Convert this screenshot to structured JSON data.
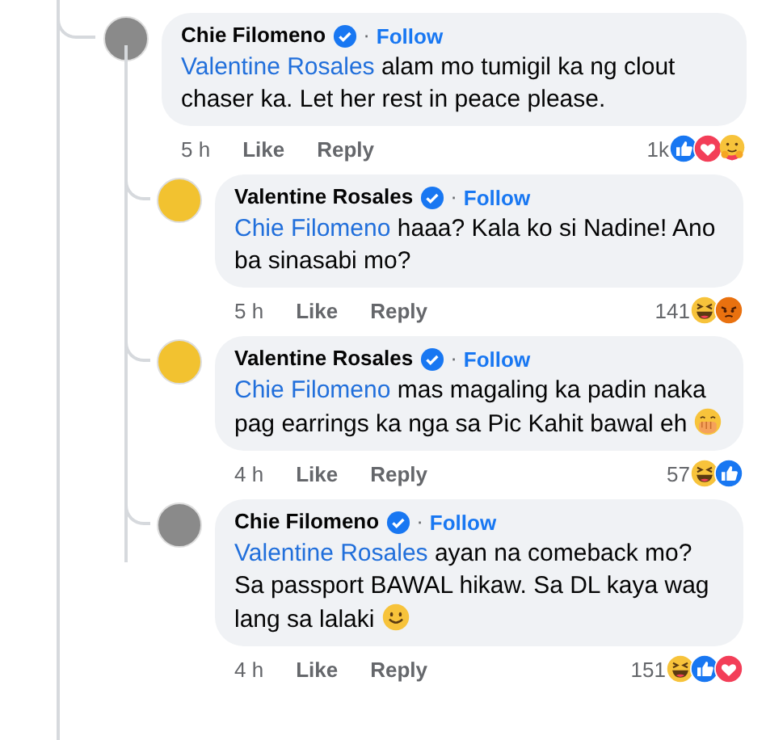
{
  "comments": [
    {
      "author": "Chie Filomeno",
      "verified": true,
      "separator": "·",
      "follow": "Follow",
      "color": "#8a8a8a",
      "mention": "Valentine Rosales",
      "text": "alam mo tumigil ka ng clout chaser ka. Let her rest in peace please.",
      "time": "5 h",
      "like": "Like",
      "reply": "Reply",
      "reaction_count": "1k",
      "reactions": [
        {
          "kind": "like"
        },
        {
          "kind": "love"
        },
        {
          "kind": "care"
        }
      ],
      "children": [
        {
          "author": "Valentine Rosales",
          "verified": true,
          "separator": "·",
          "follow": "Follow",
          "color": "#f2c230",
          "mention": "Chie Filomeno",
          "text": "haaa? Kala ko si Nadine! Ano ba sinasabi mo?",
          "time": "5 h",
          "like": "Like",
          "reply": "Reply",
          "reaction_count": "141",
          "reactions": [
            {
              "kind": "haha"
            },
            {
              "kind": "angry"
            }
          ]
        },
        {
          "author": "Valentine Rosales",
          "verified": true,
          "separator": "·",
          "follow": "Follow",
          "color": "#f2c230",
          "mention": "Chie Filomeno",
          "text": "mas magaling ka padin naka pag earrings ka nga sa Pic Kahit bawal eh",
          "emoji": {
            "kind": "hand-over-mouth"
          },
          "time": "4 h",
          "like": "Like",
          "reply": "Reply",
          "reaction_count": "57",
          "reactions": [
            {
              "kind": "haha"
            },
            {
              "kind": "like"
            }
          ]
        },
        {
          "author": "Chie Filomeno",
          "verified": true,
          "separator": "·",
          "follow": "Follow",
          "color": "#8a8a8a",
          "mention": "Valentine Rosales",
          "text": "ayan na comeback mo? Sa passport BAWAL hikaw. Sa DL kaya wag lang sa lalaki",
          "emoji": {
            "kind": "smile"
          },
          "time": "4 h",
          "like": "Like",
          "reply": "Reply",
          "reaction_count": "151",
          "reactions": [
            {
              "kind": "haha"
            },
            {
              "kind": "like"
            },
            {
              "kind": "love"
            }
          ]
        }
      ]
    }
  ]
}
